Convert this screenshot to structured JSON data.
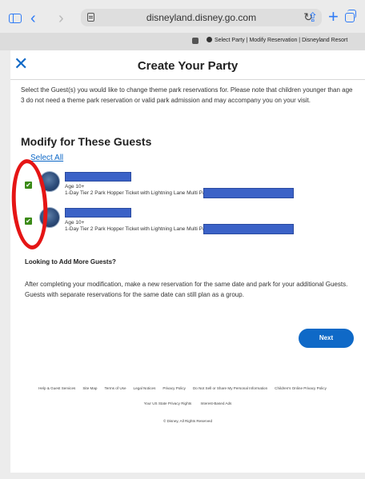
{
  "browser": {
    "url": "disneyland.disney.go.com",
    "tab_title": "Select Party | Modify Reservation | Disneyland Resort",
    "icons": [
      "sidebar-icon",
      "back-icon",
      "forward-icon",
      "reader-icon",
      "reload-icon",
      "share-icon",
      "new-tab-icon",
      "tabs-icon",
      "tab-close-icon"
    ]
  },
  "header": {
    "close_symbol": "✕",
    "title": "Create Your Party"
  },
  "intro": "Select the Guest(s) you would like to change theme park reservations for. Please note that children younger than age 3 do not need a theme park reservation or valid park admission and may accompany you on your visit.",
  "guests_section": {
    "heading": "Modify for These Guests",
    "select_all": "Select All",
    "guests": [
      {
        "checked": true,
        "age": "Age 10+",
        "ticket": "1-Day Tier 2 Park Hopper Ticket with Lightning Lane Multi Pass"
      },
      {
        "checked": true,
        "age": "Age 10+",
        "ticket": "1-Day Tier 2 Park Hopper Ticket with Lightning Lane Multi Pass"
      }
    ]
  },
  "add_guests": {
    "heading": "Looking to Add More Guests?",
    "text": "After completing your modification, make a new reservation for the same date and park for your additional Guests. Guests with separate reservations for the same date can still plan as a group."
  },
  "actions": {
    "next_label": "Next"
  },
  "footer": {
    "links": [
      "Help & Guest Services",
      "Site Map",
      "Terms of Use",
      "Legal Notices",
      "Privacy Policy",
      "Do Not Sell or Share My Personal Information",
      "Children's Online Privacy Policy"
    ],
    "links2": [
      "Your US State Privacy Rights",
      "Interest-Based Ads"
    ],
    "copyright": "© Disney, All Rights Reserved"
  },
  "colors": {
    "accent": "#0f69c7",
    "checkbox": "#3b8a18",
    "annotation": "#e51515",
    "redaction": "#3b62c7"
  }
}
